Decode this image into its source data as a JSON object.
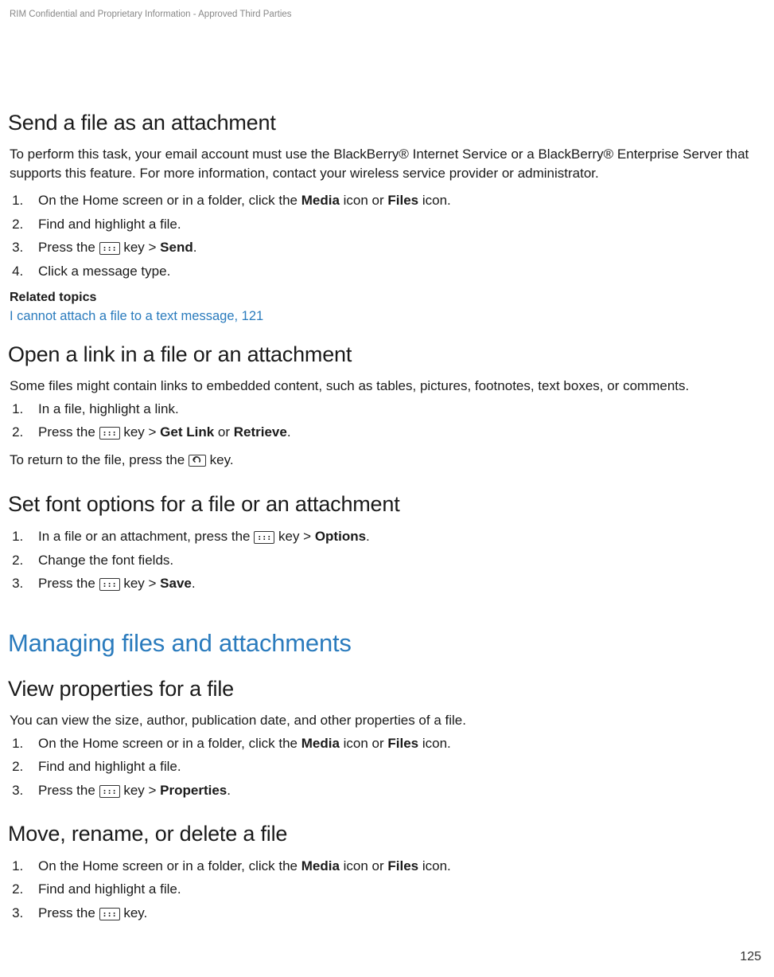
{
  "header_note": "RIM Confidential and Proprietary Information - Approved Third Parties",
  "page_number": "125",
  "related_label": "Related topics",
  "related_link": "I cannot attach a file to a text message, 121",
  "big_section": "Managing files and attachments",
  "icons": {
    "bb_key": "BlackBerry Menu key",
    "back_key": "Back/Escape key"
  },
  "sections": {
    "s1": {
      "title": "Send a file as an attachment",
      "intro": "To perform this task, your email account must use the BlackBerry® Internet Service or a BlackBerry® Enterprise Server that supports this feature. For more information, contact your wireless service provider or administrator.",
      "step1_pre": "On the Home screen or in a folder, click the ",
      "step1_b1": "Media",
      "step1_mid": " icon or ",
      "step1_b2": "Files",
      "step1_post": " icon.",
      "step2": "Find and highlight a file.",
      "step3_pre": "Press the ",
      "step3_post": " key > ",
      "step3_b": "Send",
      "step3_end": ".",
      "step4": "Click a message type."
    },
    "s2": {
      "title": "Open a link in a file or an attachment",
      "intro": "Some files might contain links to embedded content, such as tables, pictures, footnotes, text boxes, or comments.",
      "step1": "In a file, highlight a link.",
      "step2_pre": "Press the ",
      "step2_post": " key > ",
      "step2_b1": "Get Link",
      "step2_mid": " or ",
      "step2_b2": "Retrieve",
      "step2_end": ".",
      "note_pre": "To return to the file, press the ",
      "note_post": " key."
    },
    "s3": {
      "title": "Set font options for a file or an attachment",
      "step1_pre": "In a file or an attachment, press the ",
      "step1_post": " key > ",
      "step1_b": "Options",
      "step1_end": ".",
      "step2": "Change the font fields.",
      "step3_pre": "Press the ",
      "step3_post": " key > ",
      "step3_b": "Save",
      "step3_end": "."
    },
    "s4": {
      "title": "View properties for a file",
      "intro": "You can view the size, author, publication date, and other properties of a file.",
      "step1_pre": "On the Home screen or in a folder, click the ",
      "step1_b1": "Media",
      "step1_mid": " icon or ",
      "step1_b2": "Files",
      "step1_post": " icon.",
      "step2": "Find and highlight a file.",
      "step3_pre": "Press the ",
      "step3_post": " key > ",
      "step3_b": "Properties",
      "step3_end": "."
    },
    "s5": {
      "title": "Move, rename, or delete a file",
      "step1_pre": "On the Home screen or in a folder, click the ",
      "step1_b1": "Media",
      "step1_mid": " icon or ",
      "step1_b2": "Files",
      "step1_post": " icon.",
      "step2": "Find and highlight a file.",
      "step3_pre": "Press the ",
      "step3_post": " key."
    }
  }
}
